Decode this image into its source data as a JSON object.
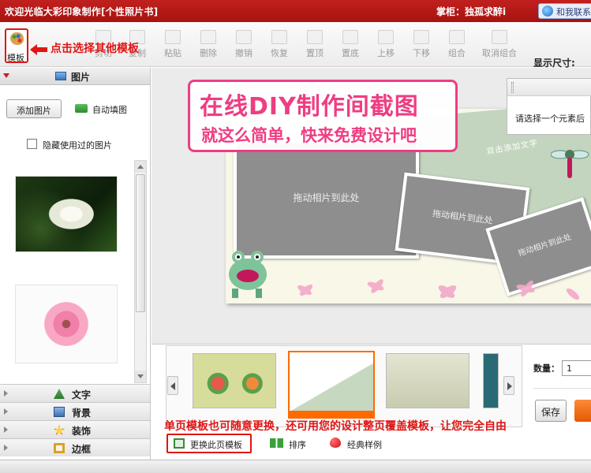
{
  "titlebar": {
    "title": "欢迎光临大彩印象制作[个性照片书]",
    "shopkeeper": "掌柜：独孤求醉i",
    "contact": "和我联系"
  },
  "toolbar": {
    "template_label": "模板",
    "template_hint": "点击选择其他模板",
    "tools": [
      "剪切",
      "复制",
      "粘贴",
      "删除",
      "撤销",
      "恢复",
      "置顶",
      "置底",
      "上移",
      "下移",
      "组合",
      "取消组合"
    ],
    "display_size_label": "显示尺寸:"
  },
  "left_panel": {
    "images_section": "图片",
    "add_image": "添加图片",
    "auto_fill": "自动填图",
    "hide_used": "隐藏使用过的图片",
    "sections": [
      "文字",
      "背景",
      "装饰",
      "边框"
    ]
  },
  "canvas": {
    "promo_line1": "在线DIY制作间截图",
    "promo_line2": "就这么简单，快来免费设计吧",
    "drop_photo": "拖动相片到此处",
    "decor_text": "双击添加文字",
    "select_tip": "请选择一个元素后"
  },
  "bottom": {
    "quantity_label": "数量：",
    "quantity_value": "1",
    "save": "保存",
    "note": "单页模板也可随意更换，还可用您的设计整页覆盖模板，让您完全自由",
    "replace_template": "更换此页模板",
    "sort": "排序",
    "classic": "经典样例"
  },
  "colors": {
    "title_bg": "#b8181a",
    "hint_red": "#e01515",
    "promo_pink": "#ee3d82",
    "selected_orange": "#ff6a00"
  }
}
